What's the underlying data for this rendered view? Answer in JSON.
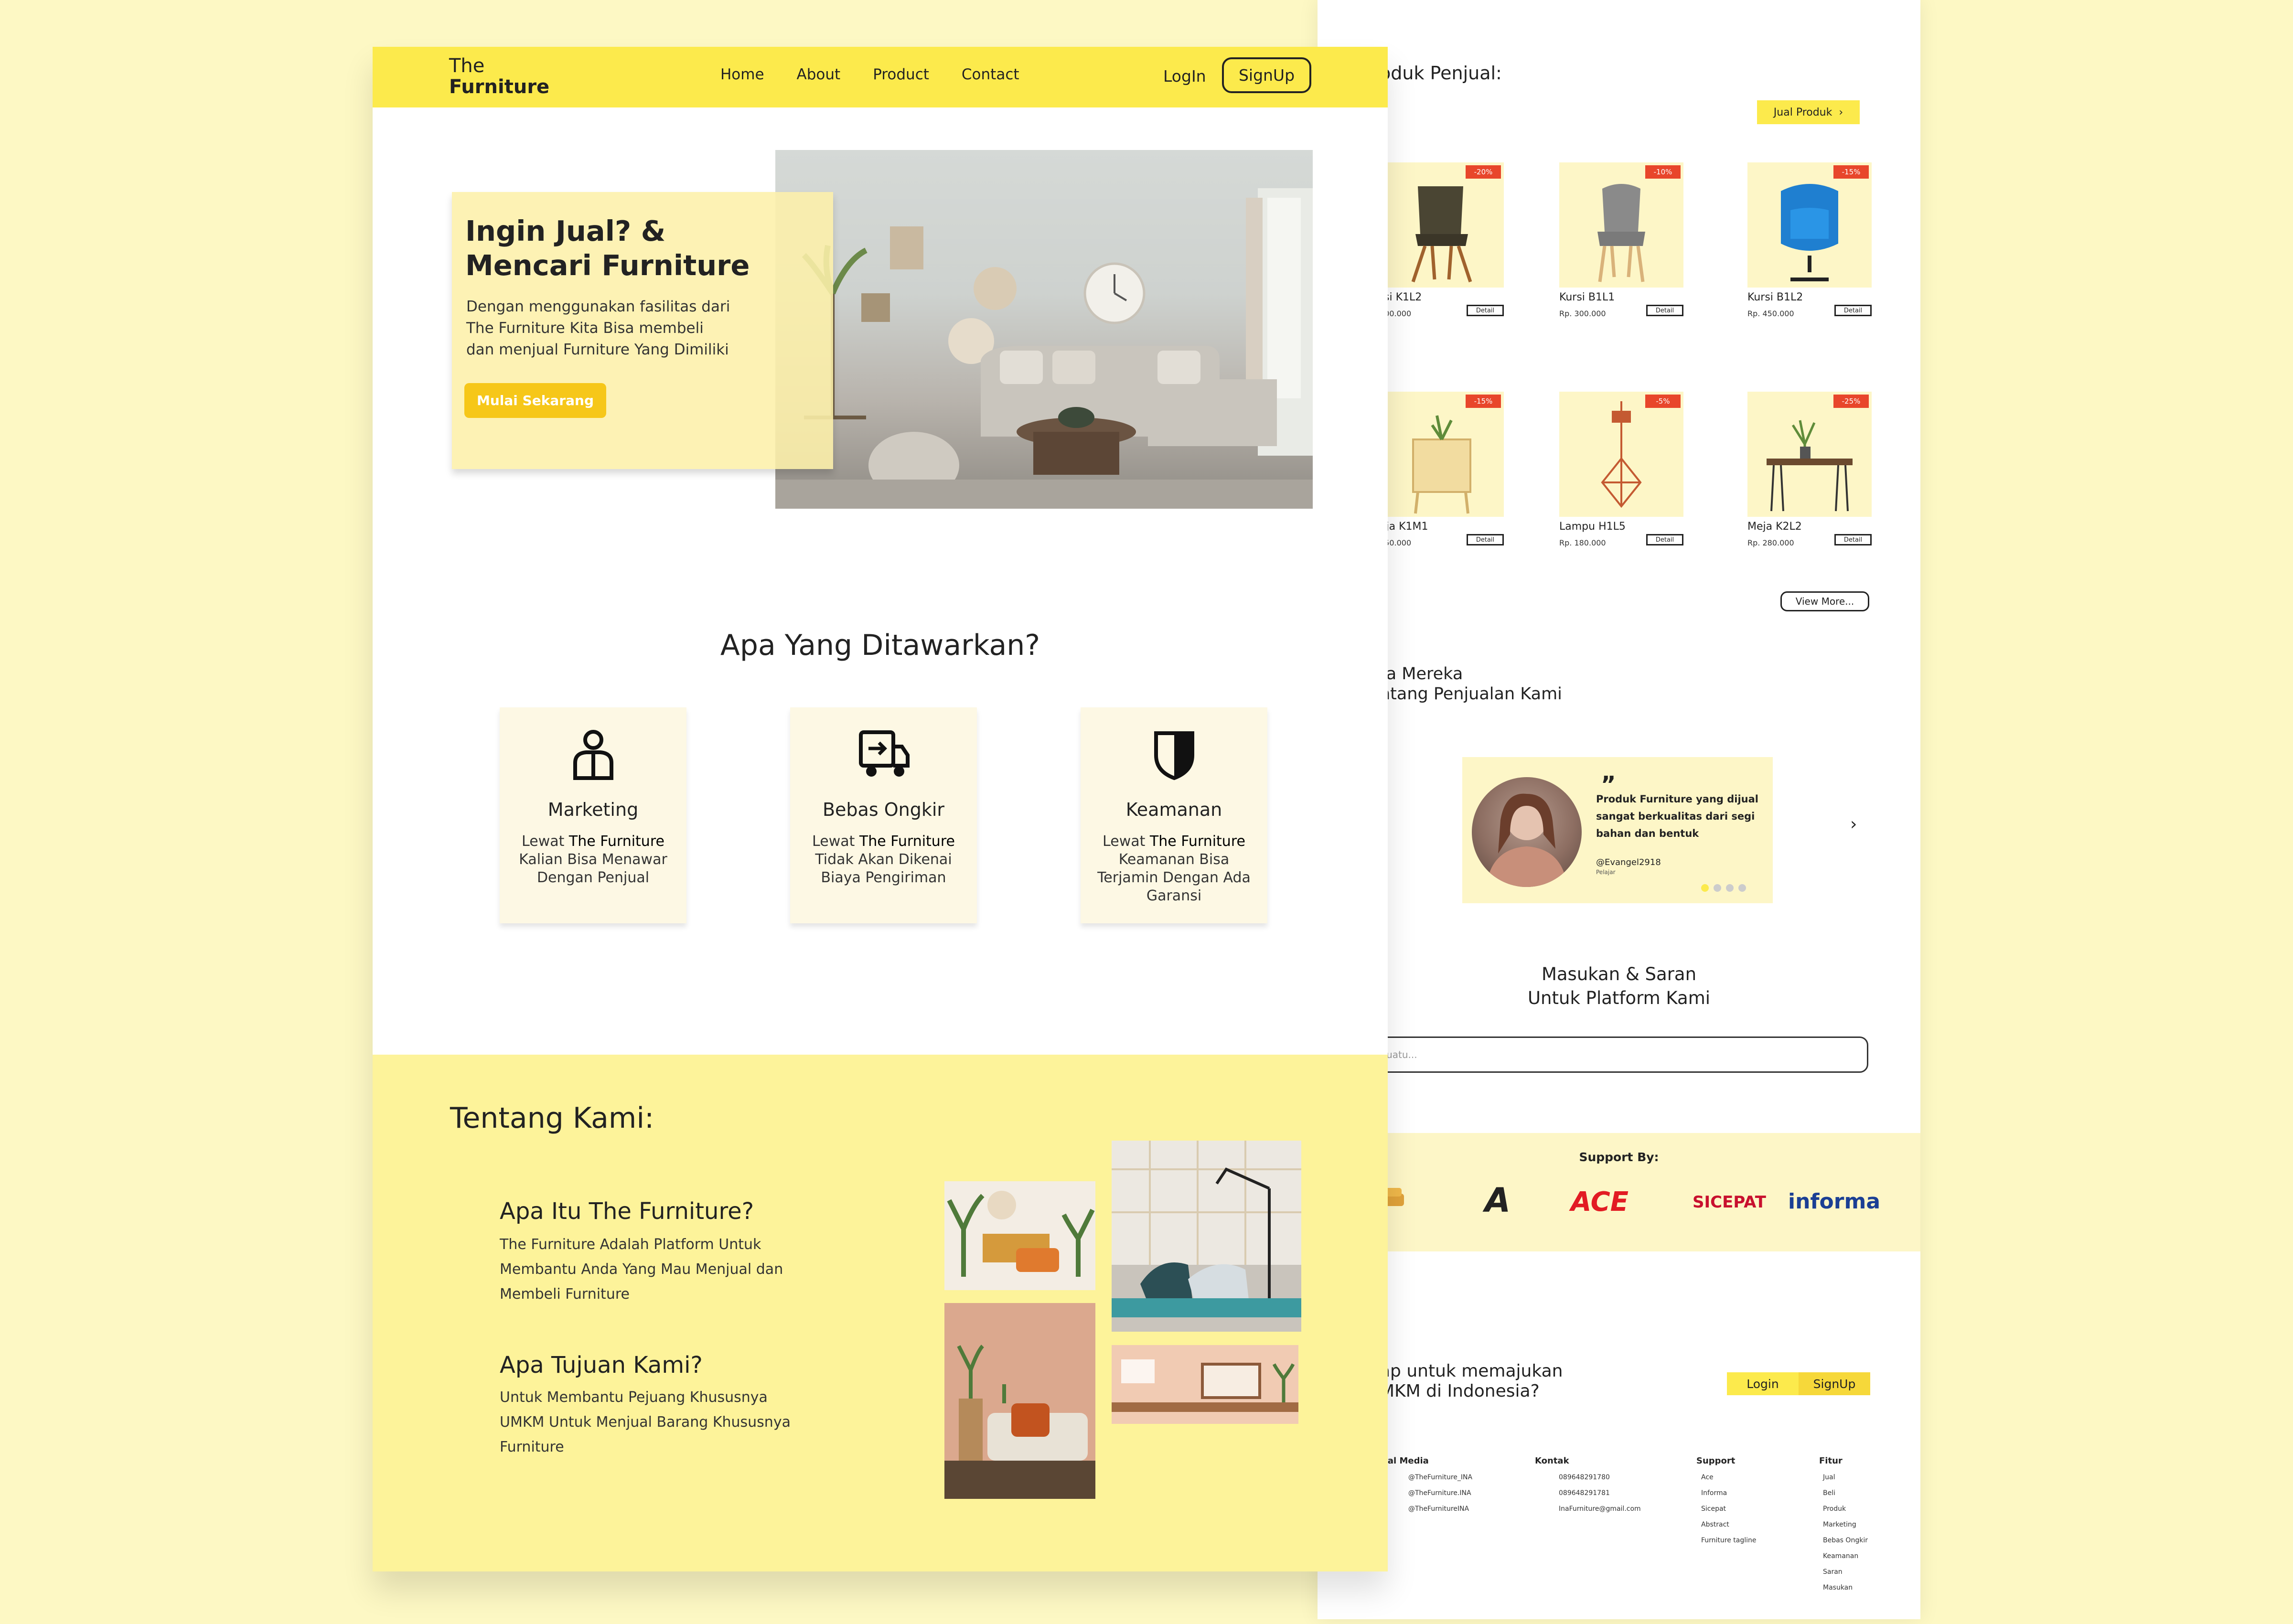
{
  "front": {
    "nav": {
      "logo_line1": "The",
      "logo_line2": "Furniture",
      "menu": [
        "Home",
        "About",
        "Product",
        "Contact"
      ],
      "login": "LogIn",
      "signup": "SignUp"
    },
    "hero": {
      "title": "Ingin Jual? & Mencari Furniture",
      "desc": "Dengan menggunakan fasilitas dari The Furniture Kita Bisa membeli dan menjual Furniture Yang Dimiliki",
      "cta": "Mulai Sekarang"
    },
    "offer": {
      "title": "Apa Yang Ditawarkan?",
      "cards": [
        {
          "title": "Marketing",
          "desc_pre": "Lewat ",
          "desc_brand": "The Furniture",
          "desc_post": " Kalian Bisa Menawar Dengan Penjual"
        },
        {
          "title": "Bebas Ongkir",
          "desc_pre": "Lewat ",
          "desc_brand": "The Furniture",
          "desc_post": " Tidak Akan Dikenai Biaya Pengiriman"
        },
        {
          "title": "Keamanan",
          "desc_pre": "Lewat ",
          "desc_brand": "The Furniture",
          "desc_post": " Keamanan Bisa Terjamin Dengan Ada Garansi"
        }
      ]
    },
    "about": {
      "title": "Tentang Kami:",
      "q1": "Apa Itu The Furniture?",
      "a1": "The Furniture Adalah Platform Untuk Membantu Anda Yang Mau Menjual dan Membeli Furniture",
      "q2": "Apa Tujuan Kami?",
      "a2": "Untuk Membantu Pejuang Khususnya UMKM Untuk Menjual Barang Khususnya Furniture"
    }
  },
  "back": {
    "products_title": "oduk Penjual:",
    "jual_button": "Jual Produk",
    "jual_chevron": "›",
    "detail_label": "Detail",
    "products": [
      {
        "name": "rsi K1L2",
        "price": "200.000",
        "discount": "-20%"
      },
      {
        "name": "Kursi B1L1",
        "price": "Rp. 300.000",
        "discount": "-10%"
      },
      {
        "name": "Kursi B1L2",
        "price": "Rp. 450.000",
        "discount": "-15%"
      },
      {
        "name": "eja K1M1",
        "price": "250.000",
        "discount": "-15%"
      },
      {
        "name": "Lampu H1L5",
        "price": "Rp. 180.000",
        "discount": "-5%"
      },
      {
        "name": "Meja K2L2",
        "price": "Rp. 280.000",
        "discount": "-25%"
      }
    ],
    "view_more": "View More...",
    "testimonial_heading_1": "ta Mereka",
    "testimonial_heading_2": "ntang Penjualan Kami",
    "testimonial": {
      "quote_mark": "”",
      "text": "Produk Furniture yang dijual sangat berkualitas dari segi bahan dan bentuk",
      "user": "@Evangel2918",
      "role": "Pelajar",
      "next": "›"
    },
    "feedback_title_1": "Masukan & Saran",
    "feedback_title_2": "Untuk Platform Kami",
    "feedback_placeholder": "etik Sesuatu...",
    "support_label": "Support By:",
    "brands": [
      "A",
      "ACE",
      "SICEPAT",
      "informa"
    ],
    "cta_line1": "ap untuk memajukan",
    "cta_line2": "MKM di Indonesia?",
    "cta_login": "Login",
    "cta_signup": "SignUp",
    "footer": {
      "sosial": {
        "title": "sial Media",
        "items": [
          "@TheFurniture_INA",
          "@TheFurniture.INA",
          "@TheFurnitureINA"
        ]
      },
      "kontak": {
        "title": "Kontak",
        "items": [
          "089648291780",
          "089648291781",
          "InaFurniture@gmail.com"
        ]
      },
      "support": {
        "title": "Support",
        "items": [
          "Ace",
          "Informa",
          "Sicepat",
          "Abstract",
          "Furniture tagline"
        ]
      },
      "fitur": {
        "title": "Fitur",
        "items": [
          "Jual",
          "Beli",
          "Produk",
          "Marketing",
          "Bebas Ongkir",
          "Keamanan",
          "Saran",
          "Masukan"
        ]
      }
    }
  },
  "colors": {
    "accent": "#fcea4c",
    "cta": "#f6c719",
    "discount": "#e8462b",
    "background": "#fdf8c4"
  }
}
